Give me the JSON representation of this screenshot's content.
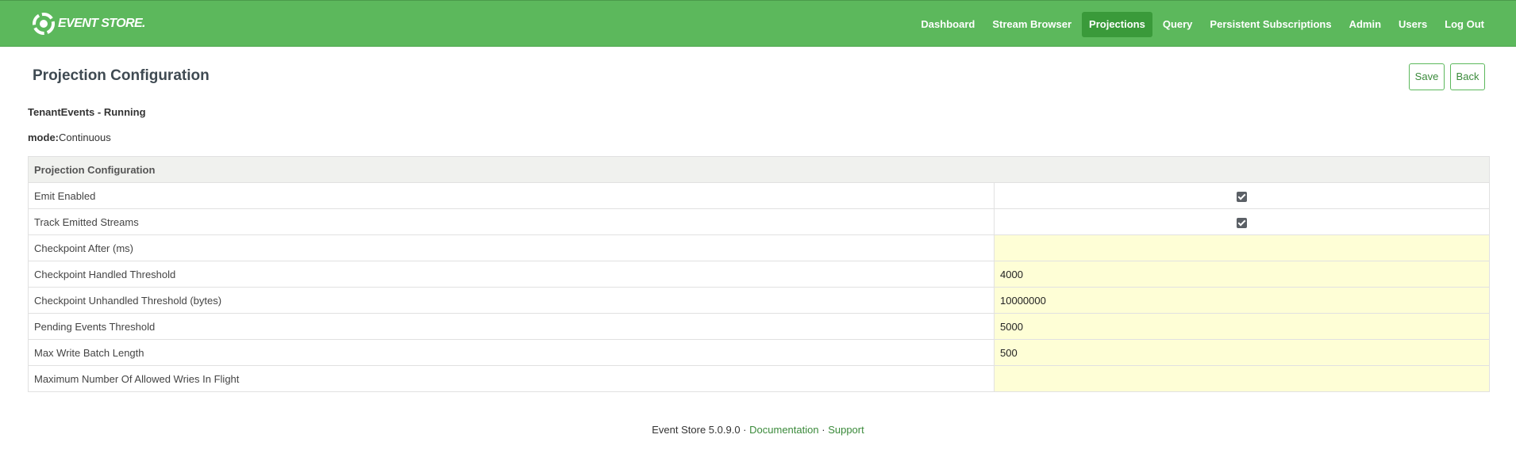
{
  "brand": {
    "name": "EVENT STORE.",
    "logo_icon": "event-store-logo-icon"
  },
  "nav": {
    "items": [
      {
        "label": "Dashboard",
        "active": false
      },
      {
        "label": "Stream Browser",
        "active": false
      },
      {
        "label": "Projections",
        "active": true
      },
      {
        "label": "Query",
        "active": false
      },
      {
        "label": "Persistent Subscriptions",
        "active": false
      },
      {
        "label": "Admin",
        "active": false
      },
      {
        "label": "Users",
        "active": false
      },
      {
        "label": "Log Out",
        "active": false
      }
    ]
  },
  "page": {
    "title": "Projection Configuration",
    "save_label": "Save",
    "back_label": "Back",
    "status": "TenantEvents - Running",
    "mode_label": "mode:",
    "mode_value": "Continuous"
  },
  "config": {
    "header": "Projection Configuration",
    "rows": [
      {
        "label": "Emit Enabled",
        "type": "checkbox",
        "checked": true
      },
      {
        "label": "Track Emitted Streams",
        "type": "checkbox",
        "checked": true
      },
      {
        "label": "Checkpoint After (ms)",
        "type": "input",
        "value": ""
      },
      {
        "label": "Checkpoint Handled Threshold",
        "type": "input",
        "value": "4000"
      },
      {
        "label": "Checkpoint Unhandled Threshold (bytes)",
        "type": "input",
        "value": "10000000"
      },
      {
        "label": "Pending Events Threshold",
        "type": "input",
        "value": "5000"
      },
      {
        "label": "Max Write Batch Length",
        "type": "input",
        "value": "500"
      },
      {
        "label": "Maximum Number Of Allowed Wries In Flight",
        "type": "input",
        "value": ""
      }
    ]
  },
  "footer": {
    "version": "Event Store 5.0.9.0",
    "separator": "·",
    "documentation": "Documentation",
    "support": "Support"
  },
  "colors": {
    "navbar": "#5cb85c",
    "active_nav": "#3a9a3a",
    "input_bg": "#fefed6"
  }
}
